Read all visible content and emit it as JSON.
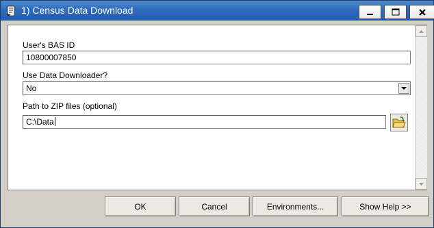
{
  "window": {
    "title": "1) Census Data Download",
    "title_icon": "script-tool-icon"
  },
  "form": {
    "bas_id": {
      "label": "User's BAS ID",
      "value": "10800007850"
    },
    "downloader": {
      "label": "Use Data Downloader?",
      "value": "No"
    },
    "zip_path": {
      "label": "Path to ZIP files (optional)",
      "value": "C:\\Data"
    }
  },
  "buttons": {
    "ok": "OK",
    "cancel": "Cancel",
    "environments": "Environments...",
    "help": "Show Help >>"
  },
  "colors": {
    "titlebar": "#2f6bbd",
    "close_button": "#c94a2c",
    "window_face": "#d4d0c8"
  }
}
